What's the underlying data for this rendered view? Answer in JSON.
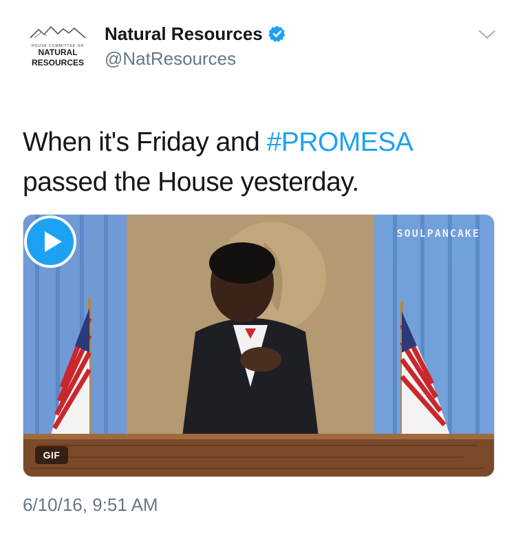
{
  "account": {
    "avatar_small_text": "HOUSE COMMITTEE ON",
    "avatar_line1": "NATURAL",
    "avatar_line2": "RESOURCES",
    "display_name": "Natural Resources",
    "handle": "@NatResources",
    "verified_icon": "verified-badge-icon"
  },
  "tweet": {
    "text_part1": "When it's Friday and ",
    "hashtag": "#PROMESA",
    "text_part2": "passed the House yesterday.",
    "timestamp": "6/10/16, 9:51 AM"
  },
  "media": {
    "watermark": "SOULPANCAKE",
    "badge": "GIF",
    "play_icon": "play-icon"
  },
  "colors": {
    "accent": "#1da1f2",
    "text": "#14171a",
    "secondary": "#657786"
  }
}
